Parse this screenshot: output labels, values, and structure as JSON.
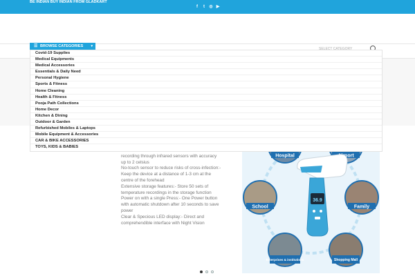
{
  "topbar": {
    "tagline": "BE INDIAN BUY INDIAN FROM GLADKART",
    "social": [
      {
        "icon": "facebook-icon",
        "glyph": "f"
      },
      {
        "icon": "twitter-icon",
        "glyph": "t"
      },
      {
        "icon": "instagram-icon",
        "glyph": "◎"
      },
      {
        "icon": "youtube-icon",
        "glyph": "▶"
      }
    ]
  },
  "nav": {
    "browse_label": "BROWSE CATEGORIES",
    "search_select": "SELECT CATEGORY"
  },
  "categories": [
    "Covid-19 Supplies",
    "Medical Equipments",
    "Medical Accessories",
    "Essentials & Daily Need",
    "Personal Hygiene",
    "Sports & Fitness",
    "Home Cleaning",
    "Health & Fitness",
    "Pooja Path Collections",
    "Home Decor",
    "Kitchen & Dining",
    "Outdoor & Garden",
    "Refurbished Mobiles & Laptops",
    "Mobile Equipment & Accessories",
    "CAR & BIKE ACCESSORIES",
    "TOYS, KIDS & BABIES"
  ],
  "product": {
    "description": [
      "Accurate Fast Reliable :- Swift and Precise recording through infrared sensors with accuracy up to 2 celsius",
      "No-touch sensor to reduce risks of cross-infection:- Keep the device at a distance of 1-3 cm at the centre of the forehead",
      "Extensive storage features:- Store 50 sets of temperature recordings in the storage function Power on with a single Press:- One Power button with automatic shutdown after 10 seconds to save power",
      "Clear & Specious LED display:- Direct and comprehendible interface with Night Vision"
    ],
    "hero_labels": {
      "hospital": "Hospital",
      "airport": "Airport",
      "school": "School",
      "family": "Family",
      "enterprises": "Enterprises & institutions",
      "mall": "Shopping Mall",
      "display": "36.9"
    }
  },
  "slider": {
    "count": 3,
    "active": 0
  },
  "colors": {
    "accent": "#20a4dc",
    "circle_border": "#1f6fb0"
  }
}
